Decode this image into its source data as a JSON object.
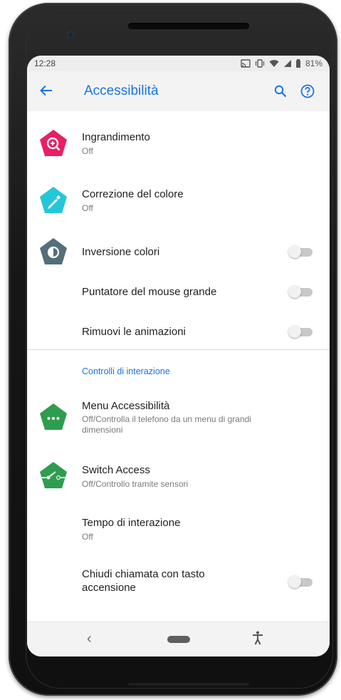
{
  "status_bar": {
    "time": "12:28",
    "battery": "81%",
    "icons": [
      "cast-icon",
      "vibrate-icon",
      "wifi-icon",
      "signal-icon",
      "battery-icon"
    ]
  },
  "toolbar": {
    "title": "Accessibilità",
    "back_icon": "arrow-back-icon",
    "search_icon": "search-icon",
    "help_icon": "help-icon"
  },
  "items": [
    {
      "label": "Ingrandimento",
      "sub": "Off",
      "icon": "magnification-icon",
      "icon_color": "#e91e63"
    },
    {
      "label": "Correzione del colore",
      "sub": "Off",
      "icon": "color-correction-icon",
      "icon_color": "#26c6da"
    },
    {
      "label": "Inversione colori",
      "icon": "color-inversion-icon",
      "icon_color": "#546e7a",
      "toggle_on": false
    },
    {
      "label": "Puntatore del mouse grande",
      "toggle_on": false
    },
    {
      "label": "Rimuovi le animazioni",
      "toggle_on": false
    }
  ],
  "interaction_section": {
    "header": "Controlli di interazione",
    "items": [
      {
        "label": "Menu Accessibilità",
        "sub": "Off/Controlla il telefono da un menu di grandi dimensioni",
        "icon": "accessibility-menu-icon",
        "icon_color": "#2e9d4f"
      },
      {
        "label": "Switch Access",
        "sub": "Off/Controllo tramite sensori",
        "icon": "switch-access-icon",
        "icon_color": "#2e9d4f"
      },
      {
        "label": "Tempo di interazione",
        "sub": "Off"
      },
      {
        "label": "Chiudi chiamata con tasto accensione",
        "toggle_on": false
      }
    ]
  },
  "nav_bar": {
    "back_glyph": "‹",
    "home_icon": "home-pill-icon",
    "accessibility_icon": "accessibility-button-icon"
  },
  "colors": {
    "accent": "#1a73e8",
    "toggle_track_off": "#c8c8c8"
  }
}
